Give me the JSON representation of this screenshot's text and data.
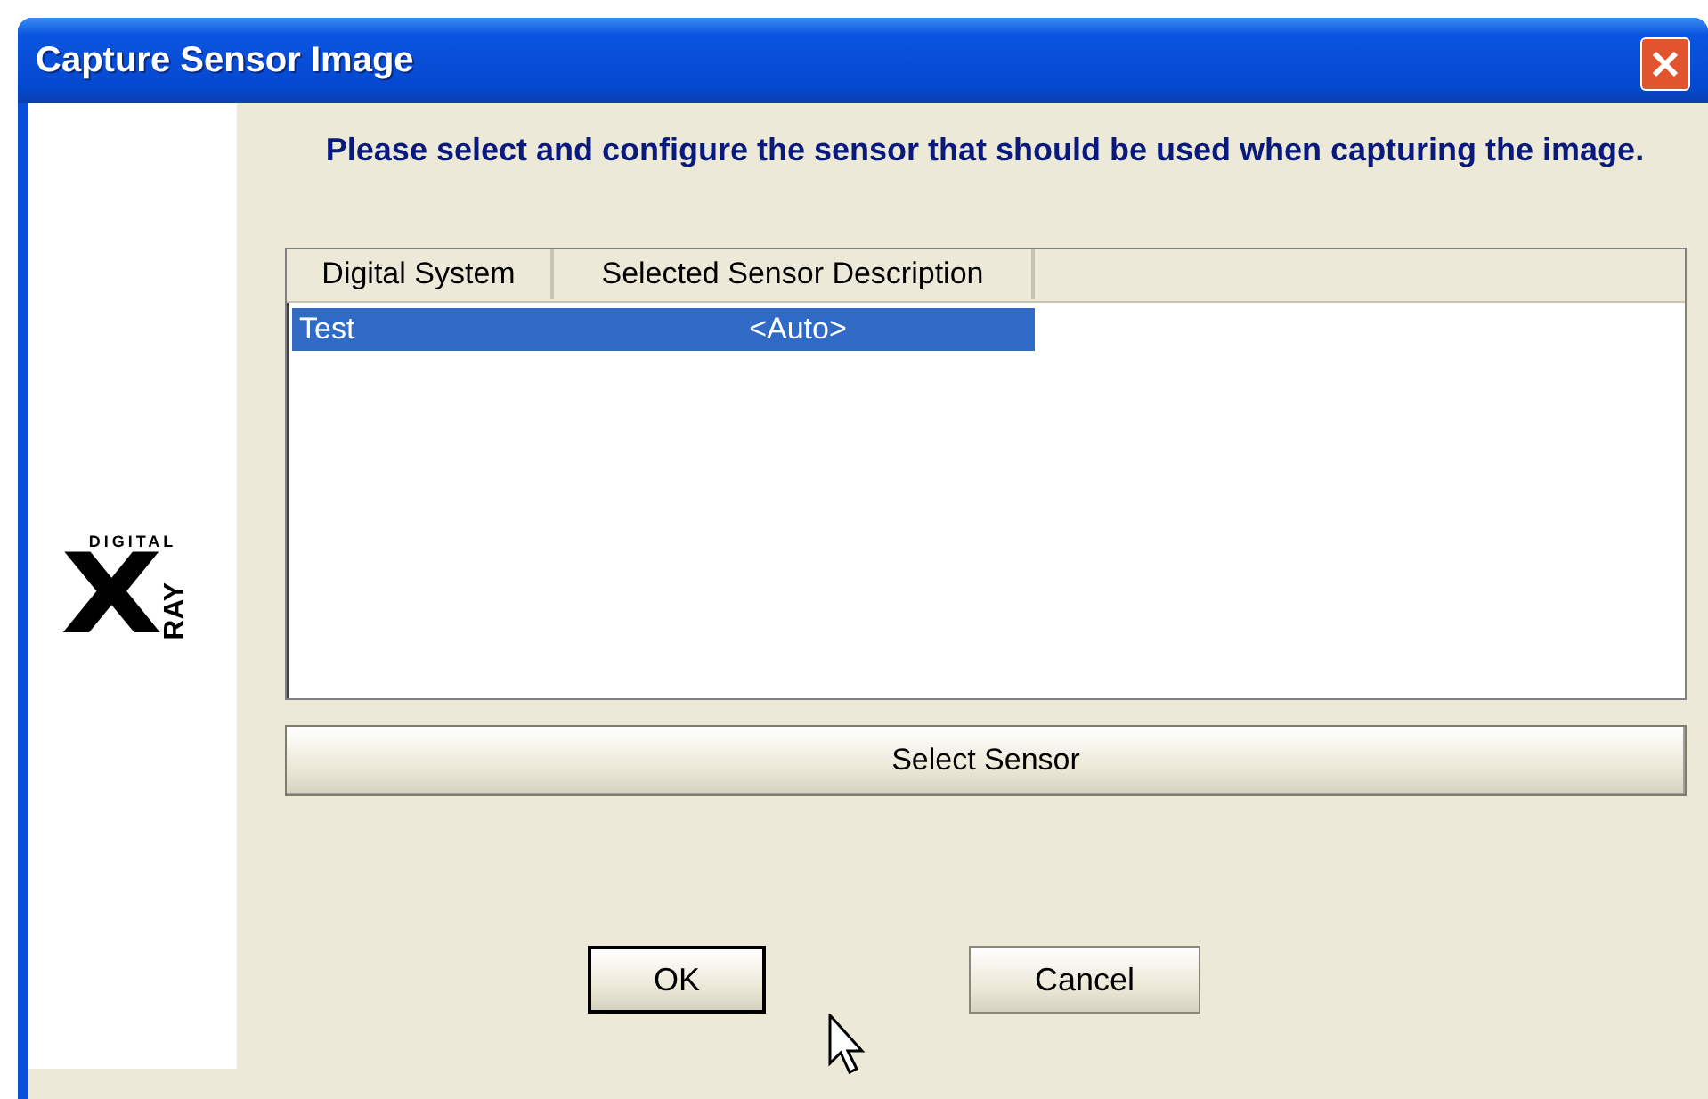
{
  "window": {
    "title": "Capture Sensor Image"
  },
  "logo": {
    "top": "DIGITAL",
    "big": "X",
    "side": "RAY"
  },
  "instruction": "Please select and configure the sensor that should be used when capturing the image.",
  "table": {
    "columns": [
      "Digital System",
      "Selected Sensor Description"
    ],
    "rows": [
      {
        "cells": [
          "Test",
          "<Auto>"
        ],
        "selected": true
      }
    ]
  },
  "select_button": "Select Sensor",
  "buttons": [
    {
      "label": "OK",
      "default": true
    },
    {
      "label": "Cancel",
      "default": false
    }
  ]
}
